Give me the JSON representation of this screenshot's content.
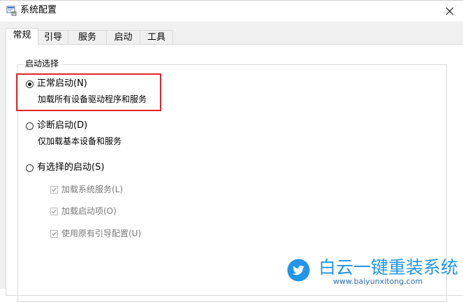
{
  "window": {
    "title": "系统配置"
  },
  "tabs": [
    {
      "label": "常规",
      "active": true
    },
    {
      "label": "引导",
      "active": false
    },
    {
      "label": "服务",
      "active": false
    },
    {
      "label": "启动",
      "active": false
    },
    {
      "label": "工具",
      "active": false
    }
  ],
  "startup_selection": {
    "legend": "启动选择",
    "options": [
      {
        "label": "正常启动(N)",
        "description": "加载所有设备驱动程序和服务",
        "selected": true
      },
      {
        "label": "诊断启动(D)",
        "description": "仅加载基本设备和服务",
        "selected": false
      },
      {
        "label": "有选择的启动(S)",
        "selected": false
      }
    ],
    "selective_items": [
      {
        "label": "加载系统服务(L)",
        "checked": true,
        "enabled": false
      },
      {
        "label": "加载启动项(O)",
        "checked": true,
        "enabled": false
      },
      {
        "label": "使用原有引导配置(U)",
        "checked": true,
        "enabled": false
      }
    ]
  },
  "annotation": {
    "highlight_color": "#e0262a"
  },
  "watermark": {
    "title": "白云一键重装系统",
    "url": "www.baiyunxitong.com",
    "color": "#2196e8"
  }
}
